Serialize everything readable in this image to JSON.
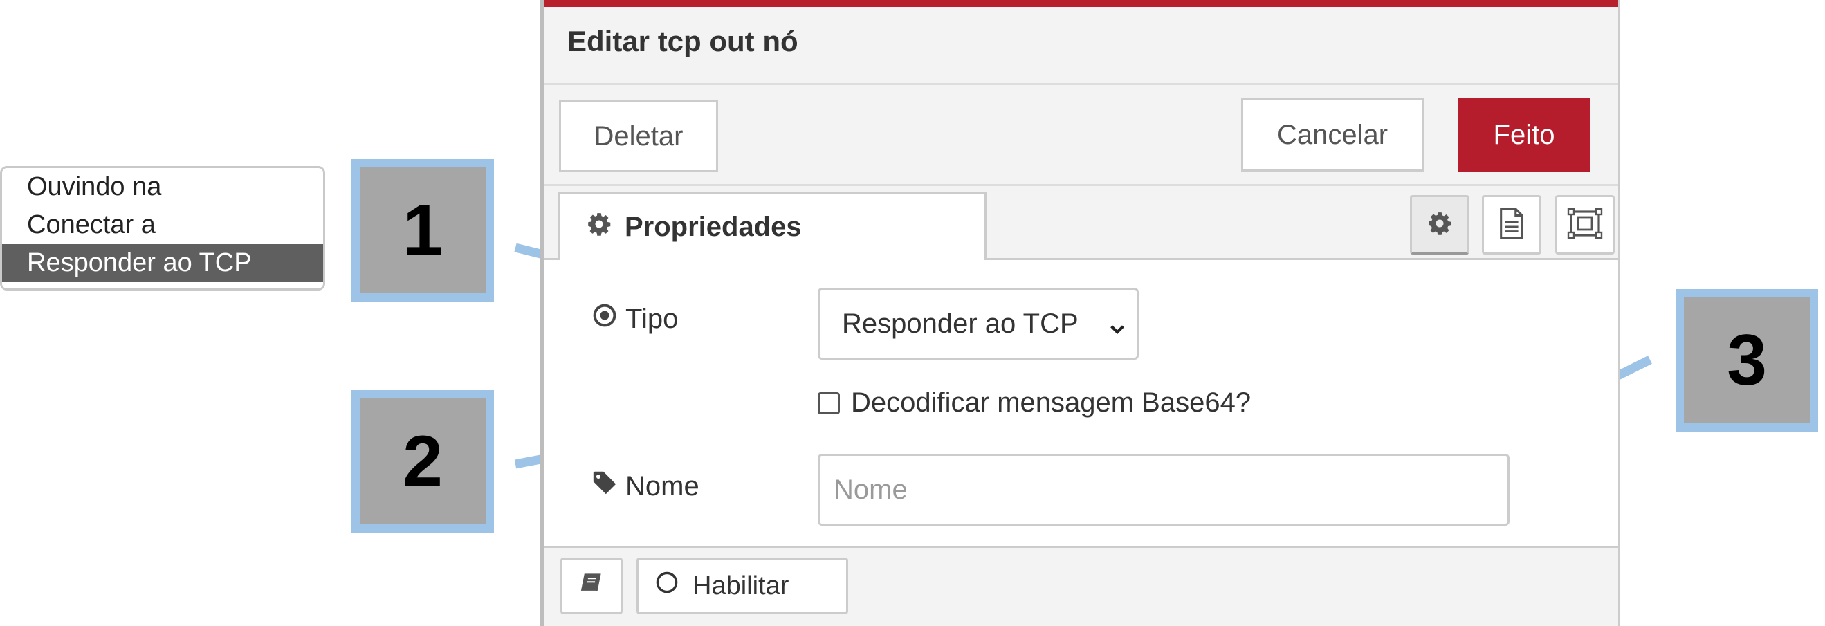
{
  "dropdown_options": {
    "items": [
      "Ouvindo na",
      "Conectar a",
      "Responder ao TCP"
    ],
    "selected_index": 2
  },
  "dialog": {
    "title": "Editar tcp out nó",
    "accent_color": "#b61d2c",
    "buttons": {
      "delete": "Deletar",
      "cancel": "Cancelar",
      "done": "Feito"
    },
    "tabs": {
      "properties": "Propriedades",
      "icons": [
        "gear-icon",
        "document-icon",
        "appearance-icon"
      ]
    },
    "form": {
      "type_label": "Tipo",
      "type_value": "Responder ao TCP",
      "base64_label": "Decodificar mensagem Base64?",
      "base64_checked": false,
      "name_label": "Nome",
      "name_placeholder": "Nome",
      "name_value": ""
    },
    "footer": {
      "enable_label": "Habilitar"
    }
  },
  "callouts": [
    "1",
    "2",
    "3"
  ]
}
